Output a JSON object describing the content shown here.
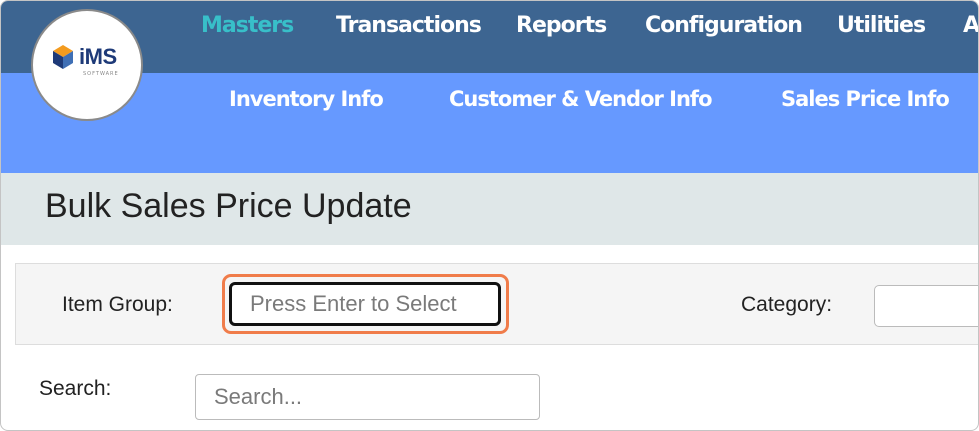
{
  "app": {
    "logo_text": "iMS",
    "logo_subtext": "SOFTWARE"
  },
  "top_nav": {
    "items": [
      {
        "label": "Masters"
      },
      {
        "label": "Transactions"
      },
      {
        "label": "Reports"
      },
      {
        "label": "Configuration"
      },
      {
        "label": "Utilities"
      },
      {
        "label": "A"
      }
    ],
    "active_color": "#38bfc9",
    "background": "#3d6591"
  },
  "sub_nav": {
    "items": [
      {
        "label": "Inventory Info"
      },
      {
        "label": "Customer & Vendor Info"
      },
      {
        "label": "Sales Price Info"
      }
    ],
    "background": "#6699ff"
  },
  "page": {
    "title": "Bulk Sales Price Update"
  },
  "filters": {
    "item_group_label": "Item Group:",
    "item_group_placeholder": "Press Enter to Select",
    "category_label": "Category:",
    "category_value": "",
    "highlight_color": "#f07c4a"
  },
  "search": {
    "label": "Search:",
    "placeholder": "Search..."
  }
}
